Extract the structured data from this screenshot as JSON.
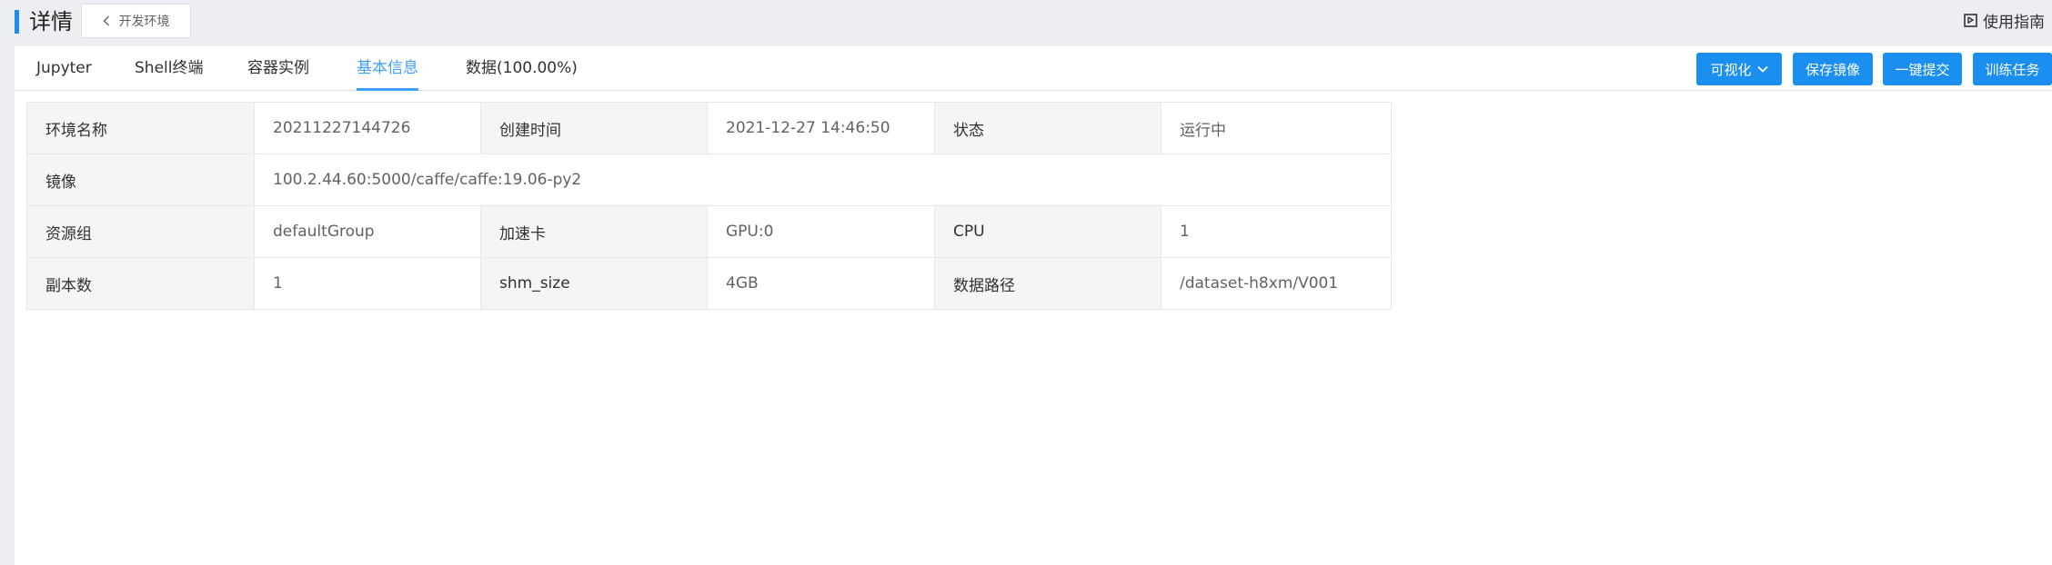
{
  "header": {
    "title": "详情",
    "back_label": "开发环境",
    "guide_label": "使用指南"
  },
  "tabs": [
    {
      "label": "Jupyter",
      "active": false
    },
    {
      "label": "Shell终端",
      "active": false
    },
    {
      "label": "容器实例",
      "active": false
    },
    {
      "label": "基本信息",
      "active": true
    },
    {
      "label": "数据(100.00%)",
      "active": false
    }
  ],
  "actions": {
    "visualize_label": "可视化",
    "save_image_label": "保存镜像",
    "submit_label": "一键提交",
    "train_label": "训练任务"
  },
  "info": {
    "env_name_label": "环境名称",
    "env_name_value": "20211227144726",
    "created_label": "创建时间",
    "created_value": "2021-12-27 14:46:50",
    "status_label": "状态",
    "status_value": "运行中",
    "image_label": "镜像",
    "image_value": "100.2.44.60:5000/caffe/caffe:19.06-py2",
    "resource_group_label": "资源组",
    "resource_group_value": "defaultGroup",
    "accelerator_label": "加速卡",
    "accelerator_value": "GPU:0",
    "cpu_label": "CPU",
    "cpu_value": "1",
    "replicas_label": "副本数",
    "replicas_value": "1",
    "shm_label": "shm_size",
    "shm_value": "4GB",
    "data_path_label": "数据路径",
    "data_path_value": "/dataset-h8xm/V001"
  },
  "colors": {
    "accent": "#1a8ff0",
    "active_tab": "#409eff",
    "page_background": "#eceef2",
    "label_cell_background": "#f5f5f5"
  },
  "icons": {
    "back": "chevron-left-icon",
    "guide": "guide-book-icon",
    "visualize_dropdown": "chevron-down-icon"
  }
}
